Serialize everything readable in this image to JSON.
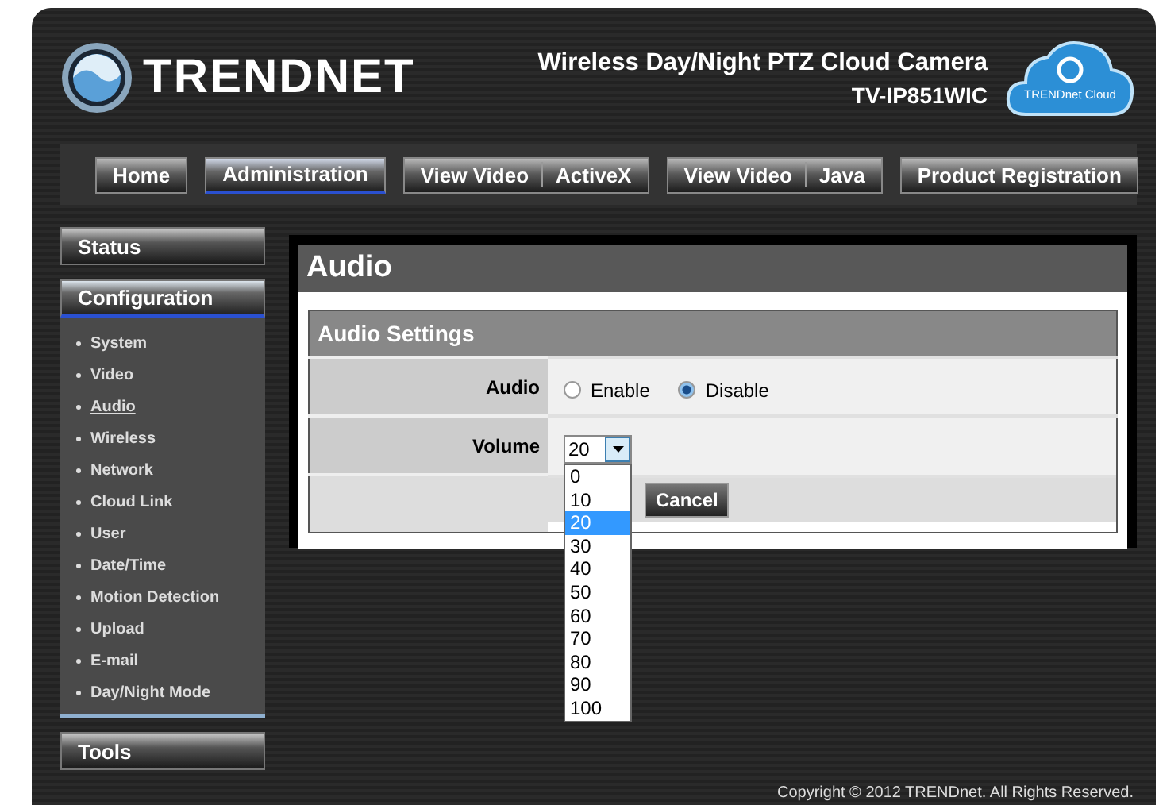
{
  "header": {
    "brand": "TRENDNET",
    "product_title": "Wireless Day/Night PTZ Cloud Camera",
    "model": "TV-IP851WIC",
    "cloud_badge": "TRENDnet Cloud"
  },
  "nav": [
    {
      "labels": [
        "Home"
      ],
      "selected": false
    },
    {
      "labels": [
        "Administration"
      ],
      "selected": true
    },
    {
      "labels": [
        "View Video",
        "ActiveX"
      ],
      "selected": false
    },
    {
      "labels": [
        "View Video",
        "Java"
      ],
      "selected": false
    },
    {
      "labels": [
        "Product Registration"
      ],
      "selected": false
    }
  ],
  "sidebar": [
    {
      "label": "Status",
      "selected": false
    },
    {
      "label": "Configuration",
      "selected": true,
      "items": [
        {
          "label": "System",
          "selected": false
        },
        {
          "label": "Video",
          "selected": false
        },
        {
          "label": "Audio",
          "selected": true
        },
        {
          "label": "Wireless",
          "selected": false
        },
        {
          "label": "Network",
          "selected": false
        },
        {
          "label": "Cloud Link",
          "selected": false
        },
        {
          "label": "User",
          "selected": false
        },
        {
          "label": "Date/Time",
          "selected": false
        },
        {
          "label": "Motion Detection",
          "selected": false
        },
        {
          "label": "Upload",
          "selected": false
        },
        {
          "label": "E-mail",
          "selected": false
        },
        {
          "label": "Day/Night Mode",
          "selected": false
        }
      ]
    },
    {
      "label": "Tools",
      "selected": false
    }
  ],
  "page_title": "Audio",
  "section_title": "Audio Settings",
  "audio": {
    "label": "Audio",
    "options": [
      {
        "label": "Enable",
        "selected": false
      },
      {
        "label": "Disable",
        "selected": true
      }
    ]
  },
  "volume": {
    "label": "Volume",
    "value": "20",
    "expanded": true,
    "options": [
      {
        "label": "0",
        "selected": false
      },
      {
        "label": "10",
        "selected": false
      },
      {
        "label": "20",
        "selected": true
      },
      {
        "label": "30",
        "selected": false
      },
      {
        "label": "40",
        "selected": false
      },
      {
        "label": "50",
        "selected": false
      },
      {
        "label": "60",
        "selected": false
      },
      {
        "label": "70",
        "selected": false
      },
      {
        "label": "80",
        "selected": false
      },
      {
        "label": "90",
        "selected": false
      },
      {
        "label": "100",
        "selected": false
      }
    ]
  },
  "cancel_button": "Cancel",
  "footer": "Copyright © 2012 TRENDnet.  All Rights Reserved."
}
